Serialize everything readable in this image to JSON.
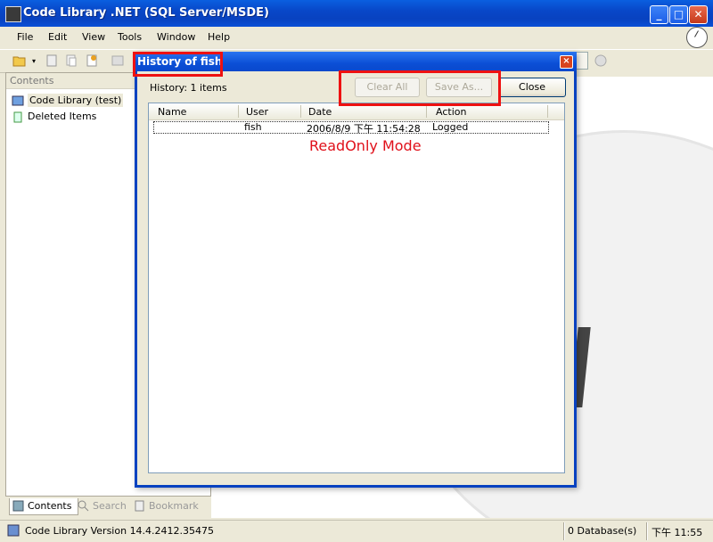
{
  "window": {
    "title": "Code Library .NET (SQL Server/MSDE)",
    "minimize": "_",
    "maximize": "□",
    "close": "✕"
  },
  "menu": [
    "File",
    "Edit",
    "View",
    "Tools",
    "Window",
    "Help"
  ],
  "left_pane": {
    "header": "Contents",
    "items": [
      "Code Library (test)",
      "Deleted Items"
    ],
    "tabs": [
      "Contents",
      "Search",
      "Bookmark"
    ]
  },
  "dialog": {
    "title": "History of fish",
    "history_count": "History: 1 items",
    "buttons": {
      "clear_all": "Clear All",
      "save_as": "Save As...",
      "close": "Close"
    },
    "columns": [
      "Name",
      "User",
      "Date",
      "Action"
    ],
    "rows": [
      {
        "name": "",
        "user": "fish",
        "date": "2006/8/9 下午 11:54:28",
        "action": "Logged"
      }
    ],
    "annotation": "ReadOnly Mode"
  },
  "status": {
    "version": "Code Library Version 14.4.2412.35475",
    "databases": "0 Database(s)",
    "time": "下午 11:55"
  },
  "colors": {
    "title_blue": "#0a48cc",
    "highlight_red": "#ee1111",
    "annotation_red": "#e0101a"
  }
}
